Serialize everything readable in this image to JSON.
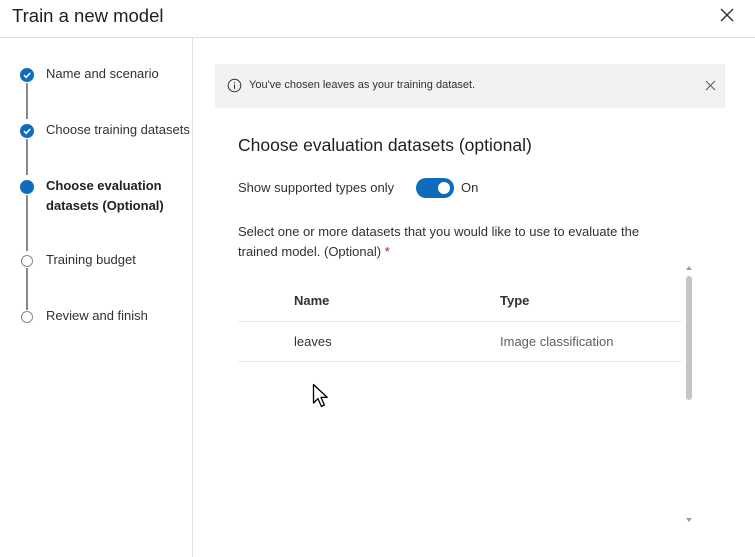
{
  "header": {
    "title": "Train a new model",
    "close_icon": "close-icon"
  },
  "steps": [
    {
      "label": "Name and scenario",
      "state": "done",
      "icon": "check-icon"
    },
    {
      "label": "Choose training datasets",
      "state": "done",
      "icon": "check-icon"
    },
    {
      "label": "Choose evaluation datasets (Optional)",
      "state": "current",
      "icon": "dot-icon"
    },
    {
      "label": "Training budget",
      "state": "todo",
      "icon": "empty-circle-icon"
    },
    {
      "label": "Review and finish",
      "state": "todo",
      "icon": "empty-circle-icon"
    }
  ],
  "banner": {
    "text": "You've chosen leaves as your training dataset.",
    "icon": "info-icon",
    "close_icon": "close-icon"
  },
  "section": {
    "title": "Choose evaluation datasets (optional)",
    "toggle_label": "Show supported types only",
    "toggle_state": "On",
    "instruction": "Select one or more datasets that you would like to use to evaluate the trained model. (Optional)",
    "required_mark": "*"
  },
  "table": {
    "headers": [
      "Name",
      "Type"
    ],
    "rows": [
      {
        "name": "leaves",
        "type": "Image classification"
      }
    ]
  },
  "colors": {
    "accent": "#0f6cbd",
    "banner_bg": "#f3f2f1",
    "required": "#a4262c"
  }
}
